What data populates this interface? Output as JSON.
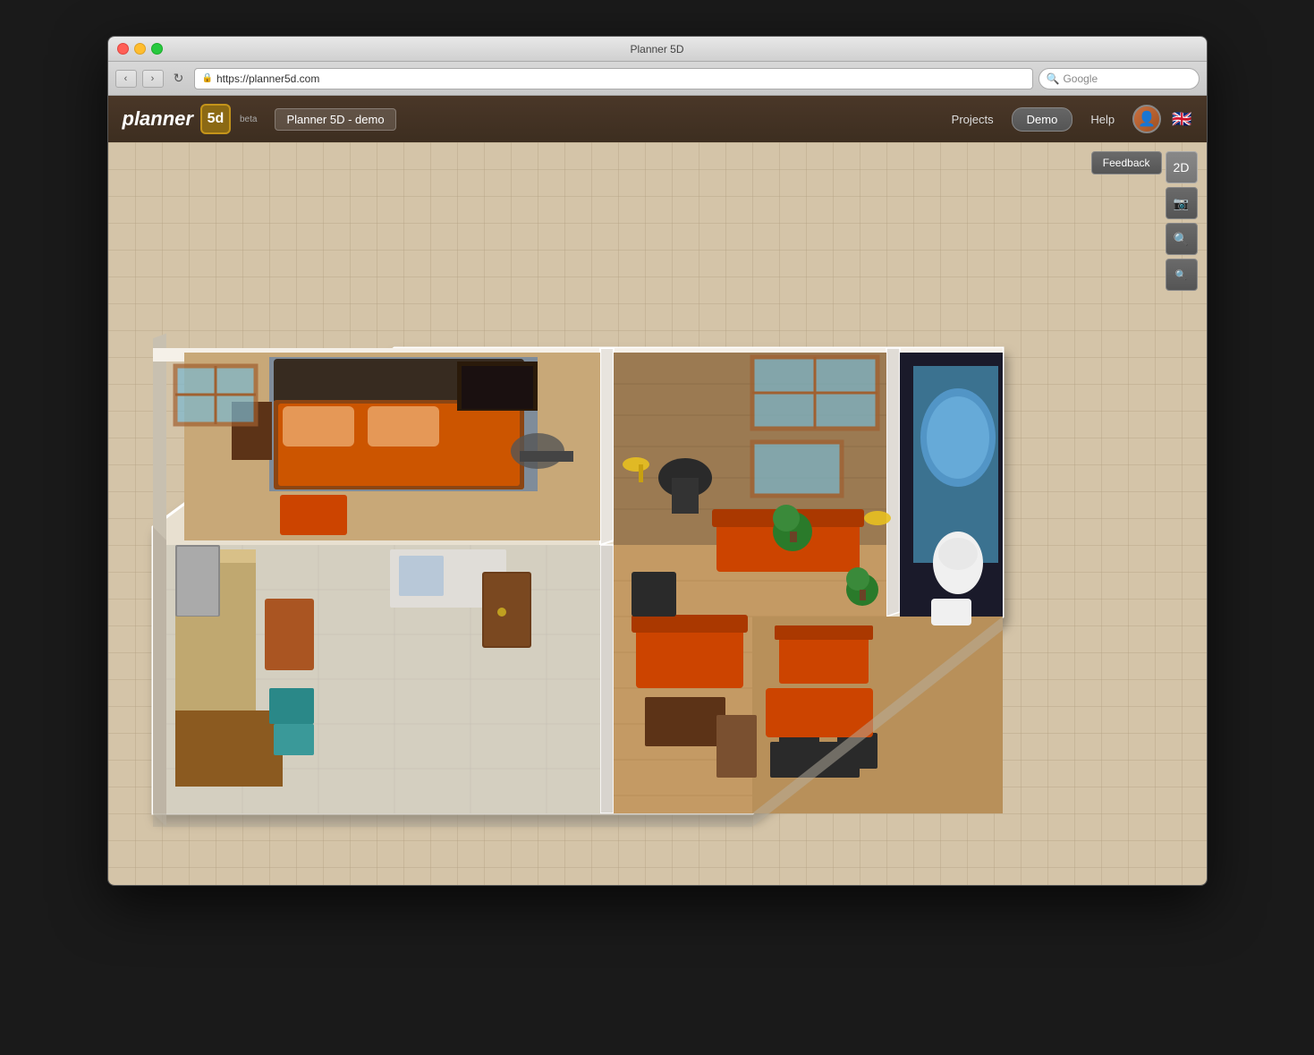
{
  "window": {
    "title": "Planner 5D",
    "os": "mac"
  },
  "browser": {
    "url": "https://planner5d.com",
    "search_placeholder": "Google",
    "back_label": "‹",
    "forward_label": "›",
    "refresh_label": "↻"
  },
  "navbar": {
    "logo_text": "planner",
    "logo_num": "5d",
    "beta_label": "beta",
    "project_name": "Planner 5D - demo",
    "projects_label": "Projects",
    "demo_label": "Demo",
    "help_label": "Help"
  },
  "canvas": {
    "feedback_label": "Feedback",
    "view_2d_label": "2D",
    "toolbar": {
      "screenshot_icon": "camera",
      "zoom_in_icon": "zoom-in",
      "zoom_out_icon": "zoom-out"
    }
  }
}
